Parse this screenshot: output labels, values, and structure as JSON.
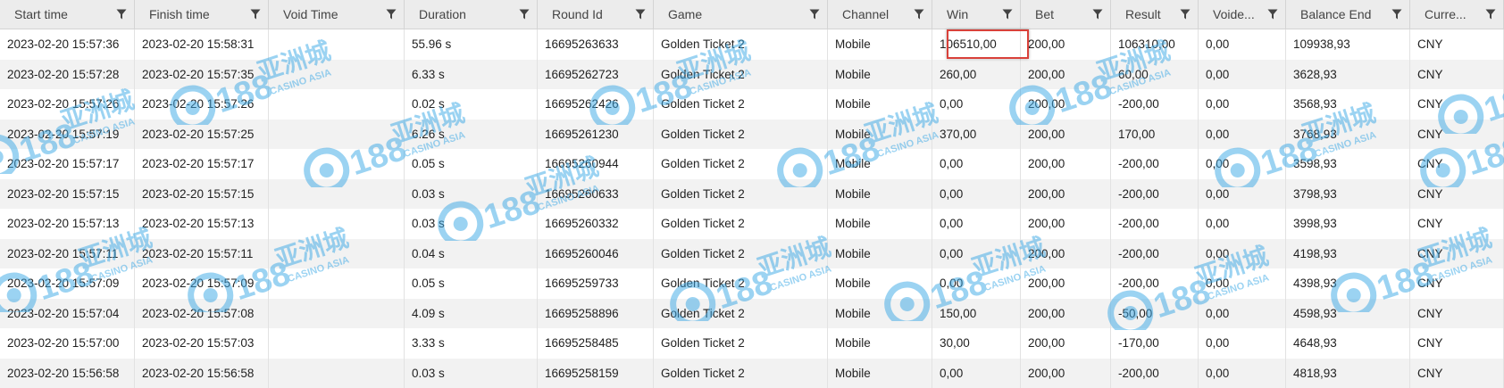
{
  "columns": [
    {
      "key": "start",
      "label": "Start time"
    },
    {
      "key": "finish",
      "label": "Finish time"
    },
    {
      "key": "void",
      "label": "Void Time"
    },
    {
      "key": "duration",
      "label": "Duration"
    },
    {
      "key": "round",
      "label": "Round Id"
    },
    {
      "key": "game",
      "label": "Game"
    },
    {
      "key": "channel",
      "label": "Channel"
    },
    {
      "key": "win",
      "label": "Win"
    },
    {
      "key": "bet",
      "label": "Bet"
    },
    {
      "key": "result",
      "label": "Result"
    },
    {
      "key": "voided",
      "label": "Voide..."
    },
    {
      "key": "balance",
      "label": "Balance End"
    },
    {
      "key": "currency",
      "label": "Curre..."
    }
  ],
  "rows": [
    [
      "2023-02-20 15:57:36",
      "2023-02-20 15:58:31",
      "",
      "55.96 s",
      "16695263633",
      "Golden Ticket 2",
      "Mobile",
      "106510,00",
      "200,00",
      "106310,00",
      "0,00",
      "109938,93",
      "CNY"
    ],
    [
      "2023-02-20 15:57:28",
      "2023-02-20 15:57:35",
      "",
      "6.33 s",
      "16695262723",
      "Golden Ticket 2",
      "Mobile",
      "260,00",
      "200,00",
      "60,00",
      "0,00",
      "3628,93",
      "CNY"
    ],
    [
      "2023-02-20 15:57:26",
      "2023-02-20 15:57:26",
      "",
      "0.02 s",
      "16695262426",
      "Golden Ticket 2",
      "Mobile",
      "0,00",
      "200,00",
      "-200,00",
      "0,00",
      "3568,93",
      "CNY"
    ],
    [
      "2023-02-20 15:57:19",
      "2023-02-20 15:57:25",
      "",
      "6.26 s",
      "16695261230",
      "Golden Ticket 2",
      "Mobile",
      "370,00",
      "200,00",
      "170,00",
      "0,00",
      "3768,93",
      "CNY"
    ],
    [
      "2023-02-20 15:57:17",
      "2023-02-20 15:57:17",
      "",
      "0.05 s",
      "16695260944",
      "Golden Ticket 2",
      "Mobile",
      "0,00",
      "200,00",
      "-200,00",
      "0,00",
      "3598,93",
      "CNY"
    ],
    [
      "2023-02-20 15:57:15",
      "2023-02-20 15:57:15",
      "",
      "0.03 s",
      "16695260633",
      "Golden Ticket 2",
      "Mobile",
      "0,00",
      "200,00",
      "-200,00",
      "0,00",
      "3798,93",
      "CNY"
    ],
    [
      "2023-02-20 15:57:13",
      "2023-02-20 15:57:13",
      "",
      "0.03 s",
      "16695260332",
      "Golden Ticket 2",
      "Mobile",
      "0,00",
      "200,00",
      "-200,00",
      "0,00",
      "3998,93",
      "CNY"
    ],
    [
      "2023-02-20 15:57:11",
      "2023-02-20 15:57:11",
      "",
      "0.04 s",
      "16695260046",
      "Golden Ticket 2",
      "Mobile",
      "0,00",
      "200,00",
      "-200,00",
      "0,00",
      "4198,93",
      "CNY"
    ],
    [
      "2023-02-20 15:57:09",
      "2023-02-20 15:57:09",
      "",
      "0.05 s",
      "16695259733",
      "Golden Ticket 2",
      "Mobile",
      "0,00",
      "200,00",
      "-200,00",
      "0,00",
      "4398,93",
      "CNY"
    ],
    [
      "2023-02-20 15:57:04",
      "2023-02-20 15:57:08",
      "",
      "4.09 s",
      "16695258896",
      "Golden Ticket 2",
      "Mobile",
      "150,00",
      "200,00",
      "-50,00",
      "0,00",
      "4598,93",
      "CNY"
    ],
    [
      "2023-02-20 15:57:00",
      "2023-02-20 15:57:03",
      "",
      "3.33 s",
      "16695258485",
      "Golden Ticket 2",
      "Mobile",
      "30,00",
      "200,00",
      "-170,00",
      "0,00",
      "4648,93",
      "CNY"
    ],
    [
      "2023-02-20 15:56:58",
      "2023-02-20 15:56:58",
      "",
      "0.03 s",
      "16695258159",
      "Golden Ticket 2",
      "Mobile",
      "0,00",
      "200,00",
      "-200,00",
      "0,00",
      "4818,93",
      "CNY"
    ]
  ],
  "highlighted_cell": {
    "row": 0,
    "column": "win"
  },
  "watermark": {
    "logo": "CC188",
    "cjk": "亚洲城",
    "sub": "CASINO ASIA",
    "color": "#3aa8e6"
  },
  "colors": {
    "header_bg": "#ececec",
    "row_alt": "#f2f2f2",
    "highlight": "#d9413a"
  },
  "icons": {
    "filter": "filter-funnel-icon"
  }
}
